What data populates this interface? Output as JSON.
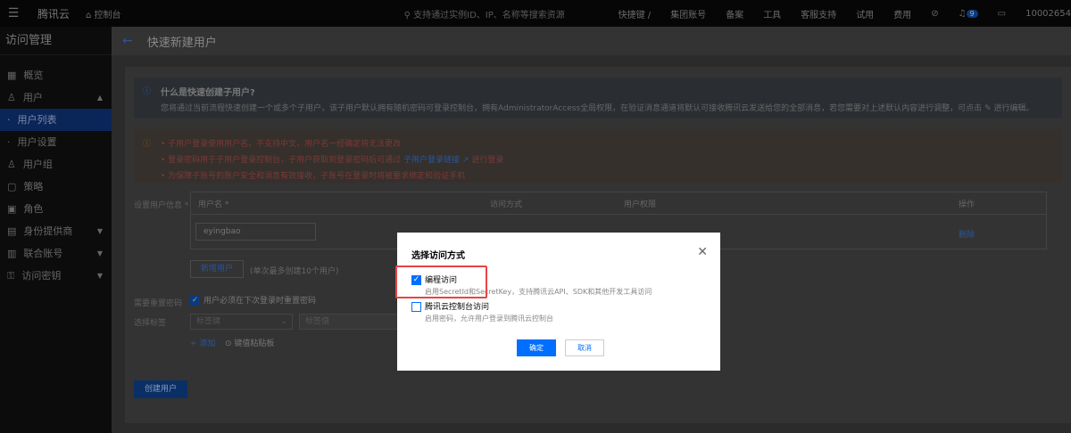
{
  "topbar": {
    "logo": "腾讯云",
    "console": "控制台",
    "search_placeholder": "支持通过实例ID、IP、名称等搜索资源",
    "shortcut": "快捷键 /",
    "nav": [
      "集团账号",
      "备案",
      "工具",
      "客服支持",
      "试用",
      "费用"
    ],
    "badge": "9",
    "account": "10002654"
  },
  "sidebar": {
    "title": "访问管理",
    "items": [
      {
        "label": "概览",
        "icon": "grid-icon"
      },
      {
        "label": "用户",
        "icon": "user-icon",
        "chev": "^"
      },
      {
        "label": "用户列表",
        "active": true
      },
      {
        "label": "用户设置"
      },
      {
        "label": "用户组",
        "icon": "users-icon"
      },
      {
        "label": "策略",
        "icon": "policy-icon"
      },
      {
        "label": "角色",
        "icon": "role-icon"
      },
      {
        "label": "身份提供商",
        "icon": "idp-icon",
        "chev": "v"
      },
      {
        "label": "联合账号",
        "icon": "federation-icon",
        "chev": "v"
      },
      {
        "label": "访问密钥",
        "icon": "key-icon",
        "chev": "v"
      }
    ]
  },
  "header": {
    "title": "快速新建用户"
  },
  "info": {
    "title": "什么是快速创建子用户?",
    "text": "您将通过当前流程快速创建一个或多个子用户，该子用户默认拥有随机密码可登录控制台，拥有AdministratorAccess全局权限，在验证消息通道将默认可接收腾讯云发送给您的全部消息，若您需要对上述默认内容进行调整，可点击 ✎ 进行编辑。"
  },
  "warn": {
    "lines": [
      "• 子用户登录使用用户名，不支持中文，用户名一经确定将无法更改",
      "• 登录密码用于子用户登录控制台，子用户获取到登录密码后可通过 ",
      "• 为保障子账号的账户安全和消息有效接收，子账号在登录时将被要求绑定和验证手机"
    ],
    "link": "子用户登录链接",
    "link_suffix": " 进行登录"
  },
  "form": {
    "user_info_label": "设置用户信息 *",
    "col_username": "用户名 *",
    "col_access": "访问方式",
    "col_permission": "用户权限",
    "col_action": "操作",
    "username_value": "eyingbao",
    "delete": "删除",
    "add_user": "新增用户",
    "add_hint": "(单次最多创建10个用户)",
    "reset_label": "需要重置密码",
    "reset_text": "用户必须在下次登录时重置密码",
    "tag_label": "选择标签",
    "tag_key": "标签键",
    "tag_value": "标签值",
    "add": "+ 添加",
    "paste": "键值粘贴板",
    "create": "创建用户"
  },
  "modal": {
    "title": "选择访问方式",
    "options": [
      {
        "label": "编程访问",
        "desc": "启用SecretId和SecretKey，支持腾讯云API、SDK和其他开发工具访问",
        "checked": true
      },
      {
        "label": "腾讯云控制台访问",
        "desc": "启用密码，允许用户登录到腾讯云控制台",
        "checked": false
      }
    ],
    "ok": "确定",
    "cancel": "取消"
  }
}
